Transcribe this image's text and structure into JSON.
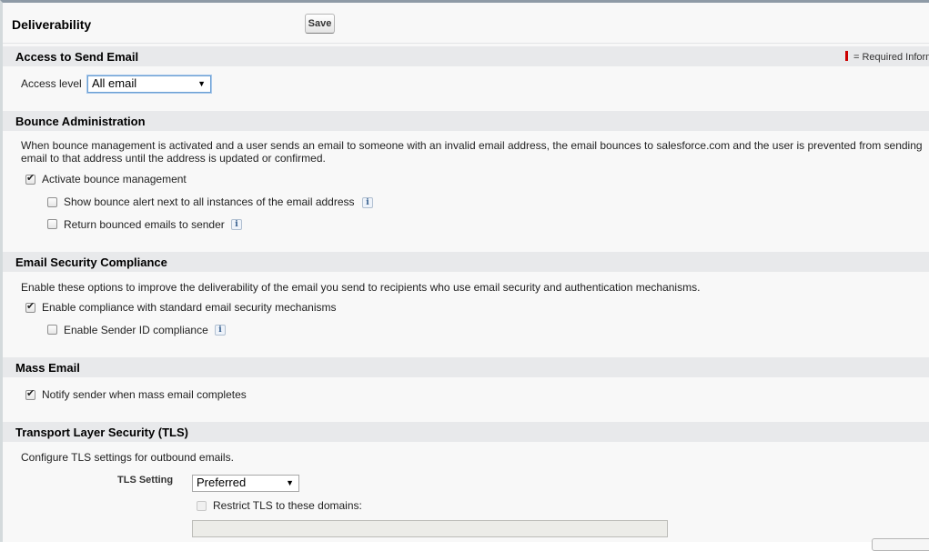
{
  "header": {
    "title": "Deliverability",
    "save_label": "Save"
  },
  "access": {
    "heading": "Access to Send Email",
    "required_legend": "= Required Information",
    "access_level_label": "Access level",
    "access_level_value": "All email"
  },
  "bounce": {
    "heading": "Bounce Administration",
    "description_line1": "When bounce management is activated and a user sends an email to someone with an invalid email address, the email bounces to salesforce.com and the user is prevented from sending",
    "description_line2": "email to that address until the address is updated or confirmed.",
    "activate_label": "Activate bounce management",
    "activate_checked": true,
    "show_alert_label": "Show bounce alert next to all instances of the email address",
    "show_alert_checked": false,
    "return_label": "Return bounced emails to sender",
    "return_checked": false
  },
  "security": {
    "heading": "Email Security Compliance",
    "description": "Enable these options to improve the deliverability of the email you send to recipients who use email security and authentication mechanisms.",
    "standard_label": "Enable compliance with standard email security mechanisms",
    "standard_checked": true,
    "sender_id_label": "Enable Sender ID compliance",
    "sender_id_checked": false
  },
  "mass": {
    "heading": "Mass Email",
    "notify_label": "Notify sender when mass email completes",
    "notify_checked": true
  },
  "tls": {
    "heading": "Transport Layer Security (TLS)",
    "description": "Configure TLS settings for outbound emails.",
    "setting_label": "TLS Setting",
    "setting_value": "Preferred",
    "restrict_label": "Restrict TLS to these domains:",
    "restrict_checked": false,
    "domains_value": ""
  },
  "icons": {
    "info": "i",
    "check": "✔",
    "dropdown": "▼"
  },
  "colors": {
    "required_marker": "#cc0000",
    "section_bar": "#e8e9eb",
    "focus_border": "#6a9fd4"
  }
}
